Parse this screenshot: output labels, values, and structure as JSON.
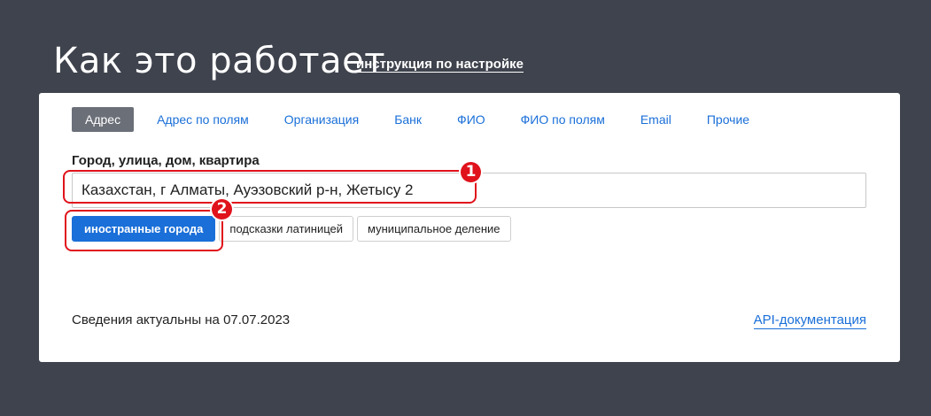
{
  "header": {
    "title": "Как это работает",
    "setup_link": "инструкция по настройке"
  },
  "tabs": [
    {
      "label": "Адрес",
      "active": true
    },
    {
      "label": "Адрес по полям",
      "active": false
    },
    {
      "label": "Организация",
      "active": false
    },
    {
      "label": "Банк",
      "active": false
    },
    {
      "label": "ФИО",
      "active": false
    },
    {
      "label": "ФИО по полям",
      "active": false
    },
    {
      "label": "Email",
      "active": false
    },
    {
      "label": "Прочие",
      "active": false
    }
  ],
  "address": {
    "label": "Город, улица, дом, квартира",
    "value": "Казахстан, г Алматы, Ауэзовский р-н, Жетысу 2"
  },
  "options": {
    "foreign_cities": "иностранные города",
    "latin_hints": "подсказки латиницей",
    "municipal": "муниципальное деление"
  },
  "footer": {
    "date_text": "Сведения актуальны на 07.07.2023",
    "api_link": "API-документация"
  },
  "annotations": {
    "marker_1": "1",
    "marker_2": "2",
    "color": "#e0121b"
  },
  "colors": {
    "background": "#3f434d",
    "accent": "#1a6fd8",
    "active_tab": "#6b6f78"
  }
}
